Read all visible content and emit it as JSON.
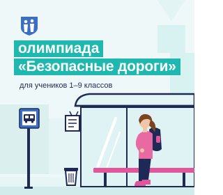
{
  "banner": {
    "title_line1": "олимпиада",
    "title_line2": "«Безопасные дороги»",
    "subtitle": "для учеников 1–9 классов"
  },
  "colors": {
    "teal": "#1fb8b0",
    "light_teal": "#d8f1f1",
    "navy": "#1e2a55",
    "bench_pink": "#e0569b",
    "shirt_pink": "#e96aa3",
    "bus_sign_blue": "#3b6fc4",
    "background": "#eef8f8"
  },
  "icons": [
    "school-logo-icon",
    "bus-icon",
    "backpack-icon",
    "bench-icon"
  ]
}
